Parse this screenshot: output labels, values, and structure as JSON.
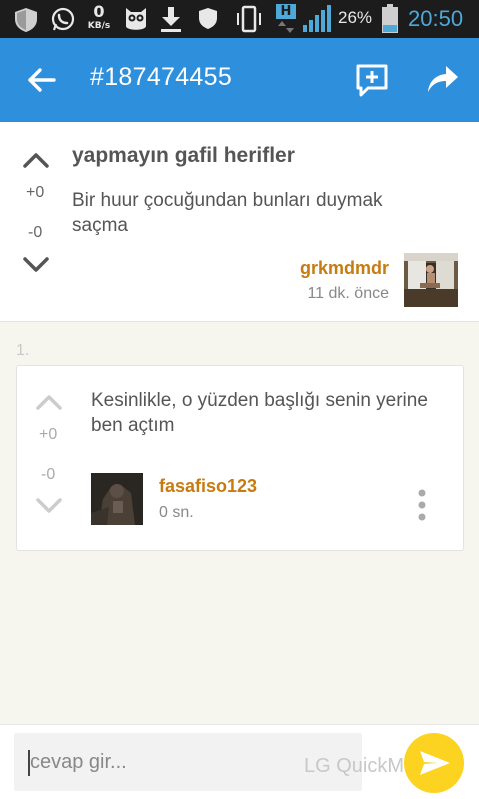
{
  "status_bar": {
    "data_speed": "0",
    "data_unit": "KB/s",
    "network_badge": "H",
    "battery": "26%",
    "clock": "20:50",
    "icons": [
      "shield-icon",
      "whatsapp-icon",
      "owl-icon",
      "download-icon",
      "shield-small-icon",
      "vibrate-icon",
      "signal-icon",
      "battery-icon"
    ]
  },
  "app_bar": {
    "title": "#187474455",
    "icons": [
      "back-arrow-icon",
      "add-comment-icon",
      "share-icon"
    ],
    "color": "#2e8fdc"
  },
  "topic": {
    "heading": "yapmayın gafil herifler",
    "body": "Bir huur çocuğundan bunları duymak saçma",
    "upvotes": "+0",
    "downvotes": "-0",
    "author": "grkmdmdr",
    "time": "11 dk. önce"
  },
  "reply": {
    "index": "1.",
    "body": "Kesinlikle, o yüzden başlığı senin yerine ben açtım",
    "upvotes": "+0",
    "downvotes": "-0",
    "author": "fasafiso123",
    "time": "0 sn."
  },
  "composer": {
    "placeholder": "cevap gir...",
    "watermark": "LG QuickMemo",
    "send_color": "#fcd320"
  },
  "colors": {
    "author": "#c77b10",
    "status_bar": "#1c1c1c",
    "background": "#f7f6ee"
  }
}
